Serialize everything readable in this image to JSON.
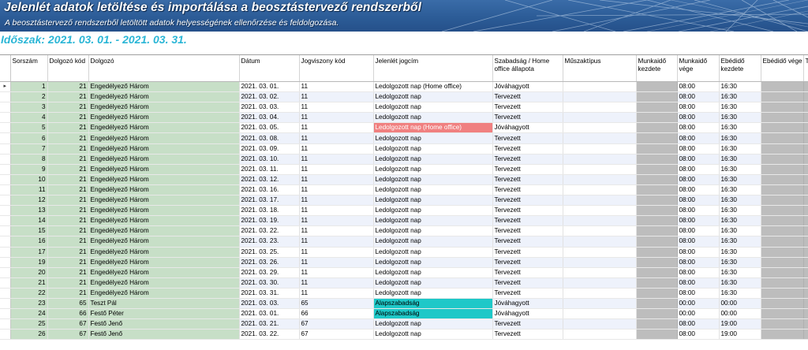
{
  "header": {
    "title": "Jelenlét adatok letöltése és importálása a beosztástervező rendszerből",
    "subtitle": "A beosztástervező rendszerből letöltött adatok helyességének ellenőrzése és feldolgozása.",
    "period": "Időszak: 2021. 03. 01. - 2021. 03. 31."
  },
  "columns": {
    "sorszam": "Sorszám",
    "dolgozo_kod": "Dolgozó kód",
    "dolgozo": "Dolgozó",
    "datum": "Dátum",
    "jogviszony_kod": "Jogviszony kód",
    "jogcim": "Jelenlét jogcím",
    "allapot": "Szabadság / Home office állapota",
    "muszaktipus": "Műszaktípus",
    "munkaido_kezdete": "Munkaidő kezdete",
    "munkaido_vege": "Munkaidő vége",
    "ebedido_kezdete": "Ebédidő kezdete",
    "ebedido_vege": "Ebédidő vége",
    "extra": "T"
  },
  "colors": {
    "highlight_pink": "#f08080",
    "highlight_cyan": "#1ec8c8",
    "id_column_green": "#c7dfc7",
    "shift_column_gray": "#bdbdbd",
    "period_text": "#2bb6d6"
  },
  "rows": [
    {
      "sorszam": "1",
      "dolgozo_kod": "21",
      "dolgozo": "Engedélyező Három",
      "datum": "2021. 03. 01.",
      "jogviszony": "11",
      "jogcim": "Ledolgozott nap (Home office)",
      "allapot": "Jóváhagyott",
      "kezdete": "08:00",
      "vege": "16:30",
      "highlight": "",
      "current": true
    },
    {
      "sorszam": "2",
      "dolgozo_kod": "21",
      "dolgozo": "Engedélyező Három",
      "datum": "2021. 03. 02.",
      "jogviszony": "11",
      "jogcim": "Ledolgozott nap",
      "allapot": "Tervezett",
      "kezdete": "08:00",
      "vege": "16:30",
      "highlight": ""
    },
    {
      "sorszam": "3",
      "dolgozo_kod": "21",
      "dolgozo": "Engedélyező Három",
      "datum": "2021. 03. 03.",
      "jogviszony": "11",
      "jogcim": "Ledolgozott nap",
      "allapot": "Tervezett",
      "kezdete": "08:00",
      "vege": "16:30",
      "highlight": ""
    },
    {
      "sorszam": "4",
      "dolgozo_kod": "21",
      "dolgozo": "Engedélyező Három",
      "datum": "2021. 03. 04.",
      "jogviszony": "11",
      "jogcim": "Ledolgozott nap",
      "allapot": "Tervezett",
      "kezdete": "08:00",
      "vege": "16:30",
      "highlight": ""
    },
    {
      "sorszam": "5",
      "dolgozo_kod": "21",
      "dolgozo": "Engedélyező Három",
      "datum": "2021. 03. 05.",
      "jogviszony": "11",
      "jogcim": "Ledolgozott nap (Home office)",
      "allapot": "Jóváhagyott",
      "kezdete": "08:00",
      "vege": "16:30",
      "highlight": "pink"
    },
    {
      "sorszam": "6",
      "dolgozo_kod": "21",
      "dolgozo": "Engedélyező Három",
      "datum": "2021. 03. 08.",
      "jogviszony": "11",
      "jogcim": "Ledolgozott nap",
      "allapot": "Tervezett",
      "kezdete": "08:00",
      "vege": "16:30",
      "highlight": ""
    },
    {
      "sorszam": "7",
      "dolgozo_kod": "21",
      "dolgozo": "Engedélyező Három",
      "datum": "2021. 03. 09.",
      "jogviszony": "11",
      "jogcim": "Ledolgozott nap",
      "allapot": "Tervezett",
      "kezdete": "08:00",
      "vege": "16:30",
      "highlight": ""
    },
    {
      "sorszam": "8",
      "dolgozo_kod": "21",
      "dolgozo": "Engedélyező Három",
      "datum": "2021. 03. 10.",
      "jogviszony": "11",
      "jogcim": "Ledolgozott nap",
      "allapot": "Tervezett",
      "kezdete": "08:00",
      "vege": "16:30",
      "highlight": ""
    },
    {
      "sorszam": "9",
      "dolgozo_kod": "21",
      "dolgozo": "Engedélyező Három",
      "datum": "2021. 03. 11.",
      "jogviszony": "11",
      "jogcim": "Ledolgozott nap",
      "allapot": "Tervezett",
      "kezdete": "08:00",
      "vege": "16:30",
      "highlight": ""
    },
    {
      "sorszam": "10",
      "dolgozo_kod": "21",
      "dolgozo": "Engedélyező Három",
      "datum": "2021. 03. 12.",
      "jogviszony": "11",
      "jogcim": "Ledolgozott nap",
      "allapot": "Tervezett",
      "kezdete": "08:00",
      "vege": "16:30",
      "highlight": ""
    },
    {
      "sorszam": "11",
      "dolgozo_kod": "21",
      "dolgozo": "Engedélyező Három",
      "datum": "2021. 03. 16.",
      "jogviszony": "11",
      "jogcim": "Ledolgozott nap",
      "allapot": "Tervezett",
      "kezdete": "08:00",
      "vege": "16:30",
      "highlight": ""
    },
    {
      "sorszam": "12",
      "dolgozo_kod": "21",
      "dolgozo": "Engedélyező Három",
      "datum": "2021. 03. 17.",
      "jogviszony": "11",
      "jogcim": "Ledolgozott nap",
      "allapot": "Tervezett",
      "kezdete": "08:00",
      "vege": "16:30",
      "highlight": ""
    },
    {
      "sorszam": "13",
      "dolgozo_kod": "21",
      "dolgozo": "Engedélyező Három",
      "datum": "2021. 03. 18.",
      "jogviszony": "11",
      "jogcim": "Ledolgozott nap",
      "allapot": "Tervezett",
      "kezdete": "08:00",
      "vege": "16:30",
      "highlight": ""
    },
    {
      "sorszam": "14",
      "dolgozo_kod": "21",
      "dolgozo": "Engedélyező Három",
      "datum": "2021. 03. 19.",
      "jogviszony": "11",
      "jogcim": "Ledolgozott nap",
      "allapot": "Tervezett",
      "kezdete": "08:00",
      "vege": "16:30",
      "highlight": ""
    },
    {
      "sorszam": "15",
      "dolgozo_kod": "21",
      "dolgozo": "Engedélyező Három",
      "datum": "2021. 03. 22.",
      "jogviszony": "11",
      "jogcim": "Ledolgozott nap",
      "allapot": "Tervezett",
      "kezdete": "08:00",
      "vege": "16:30",
      "highlight": ""
    },
    {
      "sorszam": "16",
      "dolgozo_kod": "21",
      "dolgozo": "Engedélyező Három",
      "datum": "2021. 03. 23.",
      "jogviszony": "11",
      "jogcim": "Ledolgozott nap",
      "allapot": "Tervezett",
      "kezdete": "08:00",
      "vege": "16:30",
      "highlight": ""
    },
    {
      "sorszam": "17",
      "dolgozo_kod": "21",
      "dolgozo": "Engedélyező Három",
      "datum": "2021. 03. 25.",
      "jogviszony": "11",
      "jogcim": "Ledolgozott nap",
      "allapot": "Tervezett",
      "kezdete": "08:00",
      "vege": "16:30",
      "highlight": ""
    },
    {
      "sorszam": "19",
      "dolgozo_kod": "21",
      "dolgozo": "Engedélyező Három",
      "datum": "2021. 03. 26.",
      "jogviszony": "11",
      "jogcim": "Ledolgozott nap",
      "allapot": "Tervezett",
      "kezdete": "08:00",
      "vege": "16:30",
      "highlight": ""
    },
    {
      "sorszam": "20",
      "dolgozo_kod": "21",
      "dolgozo": "Engedélyező Három",
      "datum": "2021. 03. 29.",
      "jogviszony": "11",
      "jogcim": "Ledolgozott nap",
      "allapot": "Tervezett",
      "kezdete": "08:00",
      "vege": "16:30",
      "highlight": ""
    },
    {
      "sorszam": "21",
      "dolgozo_kod": "21",
      "dolgozo": "Engedélyező Három",
      "datum": "2021. 03. 30.",
      "jogviszony": "11",
      "jogcim": "Ledolgozott nap",
      "allapot": "Tervezett",
      "kezdete": "08:00",
      "vege": "16:30",
      "highlight": ""
    },
    {
      "sorszam": "22",
      "dolgozo_kod": "21",
      "dolgozo": "Engedélyező Három",
      "datum": "2021. 03. 31.",
      "jogviszony": "11",
      "jogcim": "Ledolgozott nap",
      "allapot": "Tervezett",
      "kezdete": "08:00",
      "vege": "16:30",
      "highlight": ""
    },
    {
      "sorszam": "23",
      "dolgozo_kod": "65",
      "dolgozo": "Teszt Pál",
      "datum": "2021. 03. 03.",
      "jogviszony": "65",
      "jogcim": "Alapszabadság",
      "allapot": "Jóváhagyott",
      "kezdete": "00:00",
      "vege": "00:00",
      "highlight": "cyan"
    },
    {
      "sorszam": "24",
      "dolgozo_kod": "66",
      "dolgozo": "Festő Péter",
      "datum": "2021. 03. 01.",
      "jogviszony": "66",
      "jogcim": "Alapszabadság",
      "allapot": "Jóváhagyott",
      "kezdete": "00:00",
      "vege": "00:00",
      "highlight": "cyan"
    },
    {
      "sorszam": "25",
      "dolgozo_kod": "67",
      "dolgozo": "Festő Jenő",
      "datum": "2021. 03. 21.",
      "jogviszony": "67",
      "jogcim": "Ledolgozott nap",
      "allapot": "Tervezett",
      "kezdete": "08:00",
      "vege": "19:00",
      "highlight": ""
    },
    {
      "sorszam": "26",
      "dolgozo_kod": "67",
      "dolgozo": "Festő Jenő",
      "datum": "2021. 03. 22.",
      "jogviszony": "67",
      "jogcim": "Ledolgozott nap",
      "allapot": "Tervezett",
      "kezdete": "08:00",
      "vege": "19:00",
      "highlight": ""
    }
  ]
}
